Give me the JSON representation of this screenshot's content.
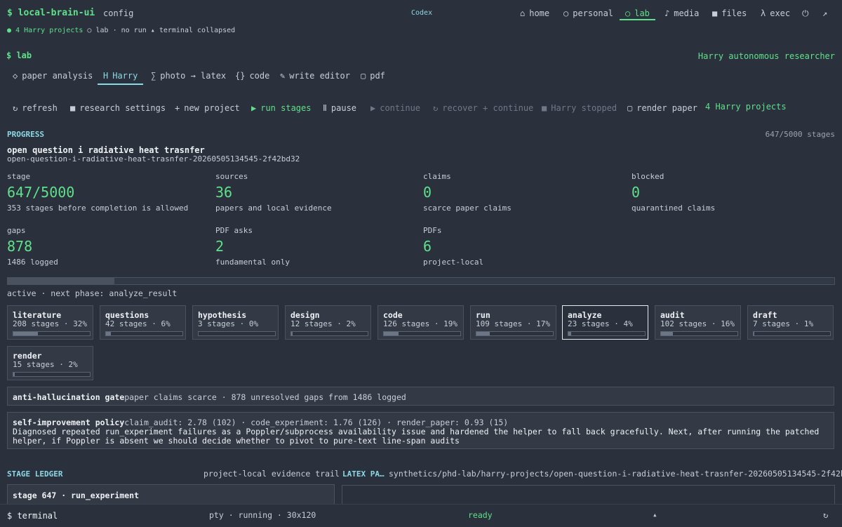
{
  "topbar": {
    "brand": "$ local-brain-ui",
    "config": "config",
    "codex": "Codex",
    "nav": [
      {
        "icon": "⌂",
        "label": "home"
      },
      {
        "icon": "○",
        "label": "personal"
      },
      {
        "icon": "⚪",
        "label": "lab"
      },
      {
        "icon": "♪",
        "label": "media"
      },
      {
        "icon": "■",
        "label": "files"
      },
      {
        "icon": "λ",
        "label": "exec"
      }
    ],
    "power_icon": "⏻",
    "expand_icon": "↗"
  },
  "statusline": {
    "projects": "4 Harry projects",
    "lab": "lab · no run",
    "terminal": "terminal collapsed"
  },
  "lab": {
    "title": "$ lab",
    "subtitle": "Harry autonomous researcher"
  },
  "tabs": [
    {
      "icon": "◇",
      "label": "paper analysis"
    },
    {
      "icon": "H",
      "label": "Harry"
    },
    {
      "icon": "∑",
      "label": "photo → latex"
    },
    {
      "icon": "{}",
      "label": "code"
    },
    {
      "icon": "✎",
      "label": "write editor"
    },
    {
      "icon": "▢",
      "label": "pdf"
    }
  ],
  "actions": [
    {
      "icon": "↻",
      "label": "refresh"
    },
    {
      "icon": "■",
      "label": "research settings"
    },
    {
      "icon": "+",
      "label": "new project"
    },
    {
      "icon": "▶",
      "label": "run stages"
    },
    {
      "icon": "Ⅱ",
      "label": "pause"
    },
    {
      "icon": "▶",
      "label": "continue"
    },
    {
      "icon": "↻",
      "label": "recover + continue"
    },
    {
      "icon": "■",
      "label": "Harry stopped"
    },
    {
      "icon": "▢",
      "label": "render paper"
    }
  ],
  "projects_count": "4 Harry projects",
  "progress": {
    "heading": "PROGRESS",
    "stages_summary": "647/5000 stages",
    "project_title": "open question i radiative heat trasnfer",
    "project_id": "open-question-i-radiative-heat-trasnfer-20260505134545-2f42bd32",
    "fraction": 0.1294,
    "metrics": [
      {
        "label": "stage",
        "value": "647/5000",
        "sub": "353 stages before completion is allowed"
      },
      {
        "label": "sources",
        "value": "36",
        "sub": "papers and local evidence"
      },
      {
        "label": "claims",
        "value": "0",
        "sub": "scarce paper claims"
      },
      {
        "label": "blocked",
        "value": "0",
        "sub": "quarantined claims"
      },
      {
        "label": "gaps",
        "value": "878",
        "sub": "1486 logged"
      },
      {
        "label": "PDF asks",
        "value": "2",
        "sub": "fundamental only"
      },
      {
        "label": "PDFs",
        "value": "6",
        "sub": "project-local"
      }
    ],
    "phase": "active · next phase: analyze_result"
  },
  "stages": [
    {
      "name": "literature",
      "stat": "208 stages · 32%",
      "pct": 32
    },
    {
      "name": "questions",
      "stat": "42 stages · 6%",
      "pct": 6
    },
    {
      "name": "hypothesis",
      "stat": "3 stages · 0%",
      "pct": 0
    },
    {
      "name": "design",
      "stat": "12 stages · 2%",
      "pct": 2
    },
    {
      "name": "code",
      "stat": "126 stages · 19%",
      "pct": 19
    },
    {
      "name": "run",
      "stat": "109 stages · 17%",
      "pct": 17
    },
    {
      "name": "analyze",
      "stat": "23 stages · 4%",
      "pct": 4
    },
    {
      "name": "audit",
      "stat": "102 stages · 16%",
      "pct": 16
    },
    {
      "name": "draft",
      "stat": "7 stages · 1%",
      "pct": 1
    },
    {
      "name": "render",
      "stat": "15 stages · 2%",
      "pct": 2
    }
  ],
  "gate": {
    "title": "anti-hallucination gate",
    "text": "paper claims scarce · 878 unresolved gaps from 1486 logged"
  },
  "policy": {
    "title": "self-improvement policy",
    "scores": "claim_audit: 2.78 (102) · code_experiment: 1.76 (126) · render_paper: 0.93 (15)",
    "line1": "Diagnosed repeated run_experiment failures as a Poppler/subprocess availability issue and hardened the helper to fall back gracefully. Next, after running the patched",
    "line2": "helper, if Poppler is absent we should decide whether to pivot to pure-text line-span audits"
  },
  "ledger": {
    "heading": "STAGE LEDGER",
    "subtitle": "project-local evidence trail",
    "entry_title": "stage 647 · run_experiment"
  },
  "latex": {
    "heading": "LATEX PA…",
    "path": "synthetics/phd-lab/harry-projects/open-question-i-radiative-heat-trasnfer-20260505134545-2f42b…"
  },
  "terminal": {
    "label": "$ terminal",
    "info": "pty · running · 30x120",
    "status": "ready",
    "toggle_icon": "▴",
    "refresh_icon": "↻"
  }
}
